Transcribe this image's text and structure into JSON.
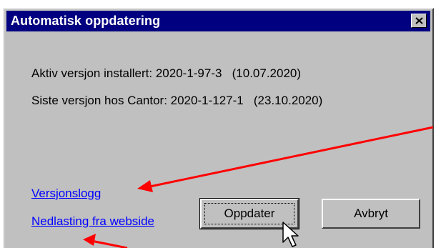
{
  "dialog": {
    "title": "Automatisk oppdatering"
  },
  "info": {
    "installed": "Aktiv versjon installert: 2020-1-97-3   (10.07.2020)",
    "latest": "Siste versjon hos Cantor: 2020-1-127-1   (23.10.2020)"
  },
  "links": {
    "version_log": "Versjonslogg",
    "download": "Nedlasting fra webside"
  },
  "buttons": {
    "update": "Oppdater",
    "cancel": "Avbryt"
  },
  "colors": {
    "titlebar": "#000080",
    "dialog_bg": "#c0c0c0",
    "link": "#0000ff",
    "annotation_arrow": "#ff0000"
  },
  "icons": [
    "close-icon",
    "mouse-cursor-icon",
    "annotation-arrow"
  ]
}
